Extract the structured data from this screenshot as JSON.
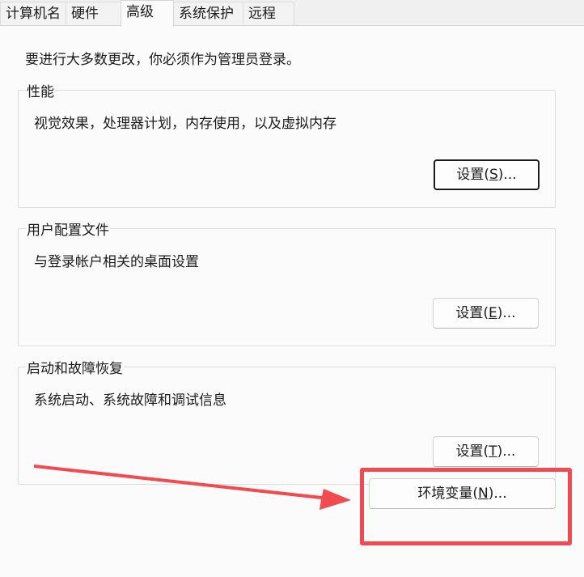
{
  "tabs": [
    {
      "label": "计算机名",
      "active": false
    },
    {
      "label": "硬件",
      "active": false
    },
    {
      "label": "高级",
      "active": true
    },
    {
      "label": "系统保护",
      "active": false
    },
    {
      "label": "远程",
      "active": false
    }
  ],
  "notice": "要进行大多数更改，你必须作为管理员登录。",
  "groups": {
    "performance": {
      "title": "性能",
      "description": "视觉效果，处理器计划，内存使用，以及虚拟内存",
      "button": {
        "prefix": "设置(",
        "accel": "S",
        "suffix": ")..."
      }
    },
    "profiles": {
      "title": "用户配置文件",
      "description": "与登录帐户相关的桌面设置",
      "button": {
        "prefix": "设置(",
        "accel": "E",
        "suffix": ")..."
      }
    },
    "startup": {
      "title": "启动和故障恢复",
      "description": "系统启动、系统故障和调试信息",
      "button": {
        "prefix": "设置(",
        "accel": "T",
        "suffix": ")..."
      }
    }
  },
  "env_button": {
    "prefix": "环境变量(",
    "accel": "N",
    "suffix": ")..."
  },
  "annotation": {
    "color": "#ef4b51",
    "icon": "arrow-right-icon"
  }
}
